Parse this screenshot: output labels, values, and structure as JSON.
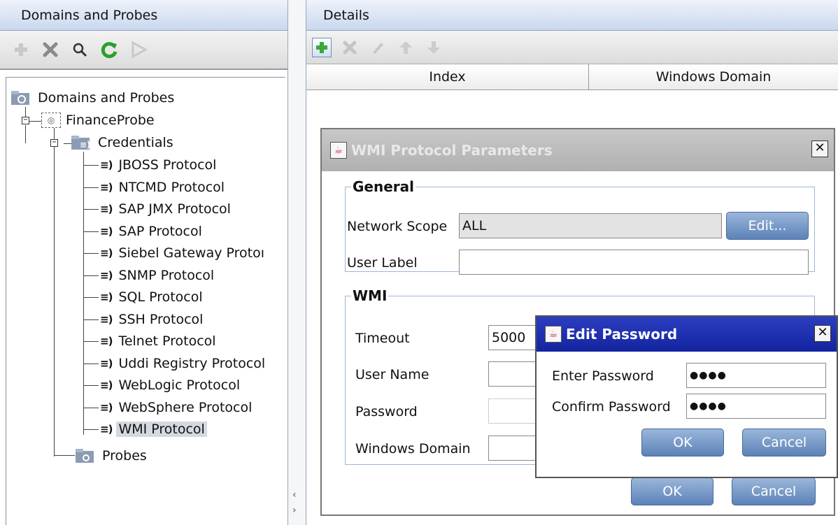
{
  "left_panel": {
    "title": "Domains and Probes",
    "tree": {
      "root": "Domains and Probes",
      "probe": "FinanceProbe",
      "credentials": "Credentials",
      "protocols": [
        "JBOSS Protocol",
        "NTCMD Protocol",
        "SAP JMX Protocol",
        "SAP Protocol",
        "Siebel Gateway Protoı",
        "SNMP Protocol",
        "SQL Protocol",
        "SSH Protocol",
        "Telnet Protocol",
        "Uddi Registry Protocol",
        "WebLogic Protocol",
        "WebSphere Protocol",
        "WMI Protocol"
      ],
      "selected": "WMI Protocol",
      "probes": "Probes"
    }
  },
  "right_panel": {
    "title": "Details",
    "columns": [
      "Index",
      "Windows Domain"
    ]
  },
  "wmi_dialog": {
    "title": "WMI Protocol Parameters",
    "general_legend": "General",
    "network_scope_label": "Network Scope",
    "network_scope_value": "ALL",
    "edit_button": "Edit...",
    "user_label_label": "User Label",
    "user_label_value": "",
    "wmi_legend": "WMI",
    "timeout_label": "Timeout",
    "timeout_value": "5000",
    "user_name_label": "User Name",
    "password_label": "Password",
    "windows_domain_label": "Windows Domain",
    "ok_button": "OK",
    "cancel_button": "Cancel"
  },
  "password_dialog": {
    "title": "Edit Password",
    "enter_label": "Enter Password",
    "enter_value": "●●●●",
    "confirm_label": "Confirm Password",
    "confirm_value": "●●●●",
    "ok_button": "OK",
    "cancel_button": "Cancel"
  },
  "close_glyph": "✕",
  "colors": {
    "header_blue": "#c9d8ee",
    "title_active": "#1424a0",
    "title_inactive": "#b0b0b0",
    "button_blue": "#5c82b8",
    "refresh_green": "#2aa02a"
  }
}
